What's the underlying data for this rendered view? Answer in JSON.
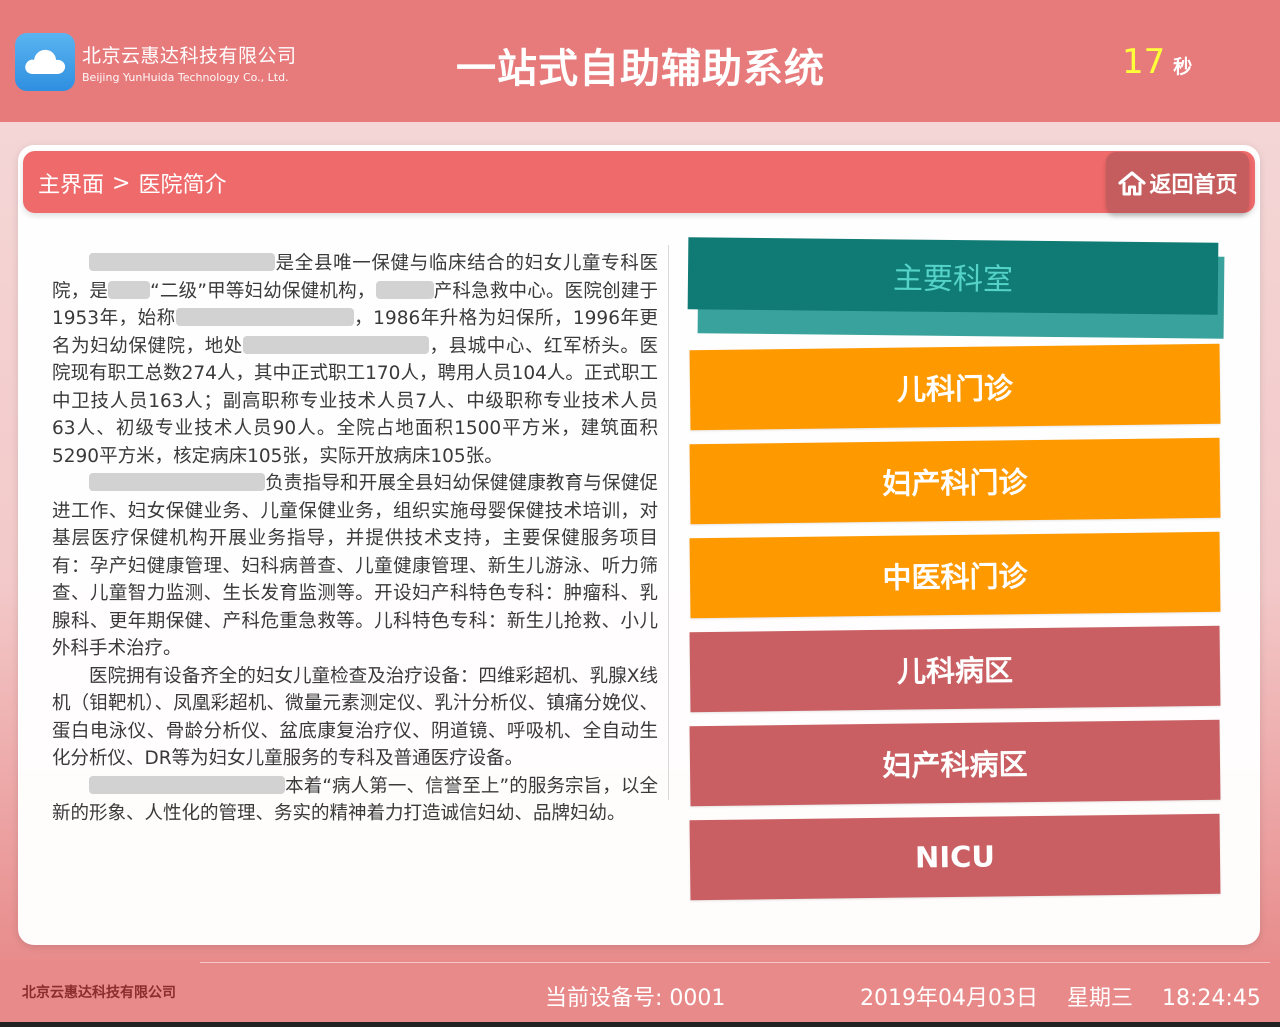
{
  "header": {
    "company_cn": "北京云惠达科技有限公司",
    "company_en": "Beijing YunHuida Technology Co., Ltd.",
    "title": "一站式自助辅助系统",
    "countdown": "17",
    "countdown_unit": "秒",
    "logo_icon": "cloud-icon"
  },
  "nav": {
    "breadcrumb_home": "主界面",
    "breadcrumb_sep": ">",
    "breadcrumb_current": "医院简介",
    "home_button": "返回首页",
    "home_icon": "home-icon"
  },
  "intro": {
    "p1_after": "是全县唯一保健与临床结合的妇女儿童专科医院，是",
    "p1_mid": "“二级”甲等妇幼保健机构，",
    "p1_tail": "产科急救中心。医院创建于1953年，始称",
    "p1_tail2": "，1986年升格为妇保所，1996年更名为妇幼保健院，地处",
    "p1_tail3": "，县城中心、红军桥头。医院现有职工总数274人，其中正式职工170人，聘用人员104人。正式职工中卫技人员163人；副高职称专业技术人员7人、中级职称专业技术人员63人、初级专业技术人员90人。全院占地面积1500平方米，建筑面积5290平方米，核定病床105张，实际开放病床105张。",
    "p2": "负责指导和开展全县妇幼保健健康教育与保健促进工作、妇女保健业务、儿童保健业务，组织实施母婴保健技术培训，对基层医疗保健机构开展业务指导，并提供技术支持，主要保健服务项目有：孕产妇健康管理、妇科病普查、儿童健康管理、新生儿游泳、听力筛查、儿童智力监测、生长发育监测等。开设妇产科特色专科：肿瘤科、乳腺科、更年期保健、产科危重急救等。儿科特色专科：新生儿抢救、小儿外科手术治疗。",
    "p3": "医院拥有设备齐全的妇女儿童检查及治疗设备：四维彩超机、乳腺X线机（钼靶机）、凤凰彩超机、微量元素测定仪、乳汁分析仪、镇痛分娩仪、蛋白电泳仪、骨龄分析仪、盆底康复治疗仪、阴道镜、呼吸机、全自动生化分析仪、DR等为妇女儿童服务的专科及普通医疗设备。",
    "p4": "本着“病人第一、信誉至上”的服务宗旨，以全新的形象、人性化的管理、务实的精神着力打造诚信妇幼、品牌妇幼。"
  },
  "departments": {
    "title": "主要科室",
    "items": [
      {
        "label": "儿科门诊",
        "color": "#ff9900"
      },
      {
        "label": "妇产科门诊",
        "color": "#ff9900"
      },
      {
        "label": "中医科门诊",
        "color": "#ff9900"
      },
      {
        "label": "儿科病区",
        "color": "#c95f62"
      },
      {
        "label": "妇产科病区",
        "color": "#c95f62"
      },
      {
        "label": "NICU",
        "color": "#c95f62"
      }
    ]
  },
  "footer": {
    "company": "北京云惠达科技有限公司",
    "device_label": "当前设备号: 0001",
    "date": "2019年04月03日",
    "weekday": "星期三",
    "time": "18:24:45"
  }
}
